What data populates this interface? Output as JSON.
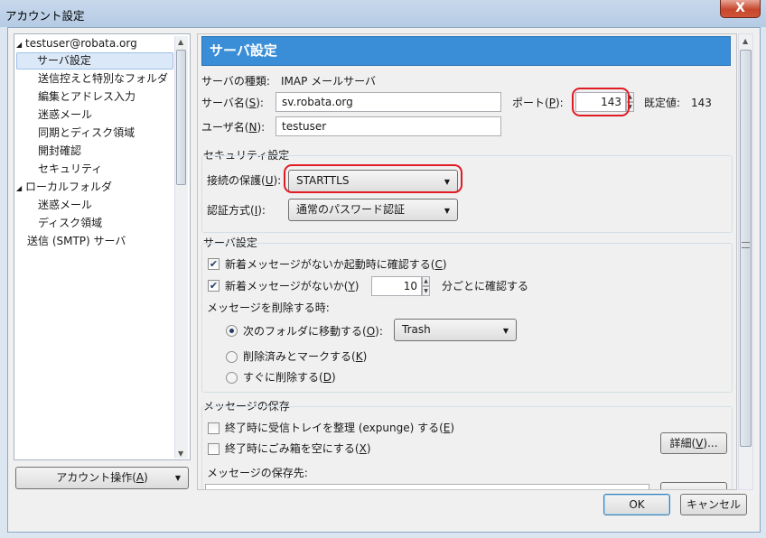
{
  "window": {
    "title": "アカウント設定",
    "close_glyph": "X"
  },
  "tree": {
    "items": [
      {
        "label": "testuser@robata.org",
        "expander": "◢"
      },
      {
        "label": "サーバ設定"
      },
      {
        "label": "送信控えと特別なフォルダ"
      },
      {
        "label": "編集とアドレス入力"
      },
      {
        "label": "迷惑メール"
      },
      {
        "label": "同期とディスク領域"
      },
      {
        "label": "開封確認"
      },
      {
        "label": "セキュリティ"
      },
      {
        "label": "ローカルフォルダ",
        "expander": "◢"
      },
      {
        "label": "迷惑メール"
      },
      {
        "label": "ディスク領域"
      },
      {
        "label": "送信 (SMTP) サーバ"
      }
    ],
    "account_actions": {
      "label": "アカウント操作(",
      "key": "A",
      "tail": ")"
    }
  },
  "panel": {
    "header": "サーバ設定",
    "server_type_label": "サーバの種類:",
    "server_type_value": "IMAP メールサーバ",
    "server_name": {
      "label": "サーバ名(",
      "key": "S",
      "tail": "):",
      "value": "sv.robata.org"
    },
    "port": {
      "label": "ポート(",
      "key": "P",
      "tail": "):",
      "value": "143",
      "default_label": "既定値:",
      "default_value": "143"
    },
    "username": {
      "label": "ユーザ名(",
      "key": "N",
      "tail": "):",
      "value": "testuser"
    },
    "security": {
      "title": "セキュリティ設定",
      "connection": {
        "label": "接続の保護(",
        "key": "U",
        "tail": "):",
        "value": "STARTTLS"
      },
      "auth": {
        "label": "認証方式(",
        "key": "I",
        "tail": "):",
        "value": "通常のパスワード認証"
      }
    },
    "server_settings": {
      "title": "サーバ設定",
      "check_startup": {
        "label": "新着メッセージがないか起動時に確認する(",
        "key": "C",
        "tail": ")",
        "checked": true,
        "mark": "✔"
      },
      "check_interval": {
        "label": "新着メッセージがないか(",
        "key": "Y",
        "tail": ")",
        "checked": true,
        "mark": "✔",
        "value": "10",
        "suffix": "分ごとに確認する"
      },
      "delete_title": "メッセージを削除する時:",
      "move": {
        "label": "次のフォルダに移動する(",
        "key": "O",
        "tail": "):",
        "selected": true,
        "folder": "Trash"
      },
      "mark_deleted": {
        "label": "削除済みとマークする(",
        "key": "K",
        "tail": ")",
        "selected": false
      },
      "delete_now": {
        "label": "すぐに削除する(",
        "key": "D",
        "tail": ")",
        "selected": false
      }
    },
    "storage": {
      "title": "メッセージの保存",
      "expunge": {
        "label": "終了時に受信トレイを整理 (expunge) する(",
        "key": "E",
        "tail": ")",
        "checked": false
      },
      "empty_trash": {
        "label": "終了時にごみ箱を空にする(",
        "key": "X",
        "tail": ")",
        "checked": false
      },
      "advanced": {
        "label": "詳細(",
        "key": "V",
        "tail": ")..."
      },
      "location_label": "メッセージの保存先:"
    }
  },
  "buttons": {
    "ok": "OK",
    "cancel": "キャンセル"
  },
  "colors": {
    "header": "#3a8ed8",
    "highlight": "#e01b24",
    "selection": "#dbe8f8"
  }
}
